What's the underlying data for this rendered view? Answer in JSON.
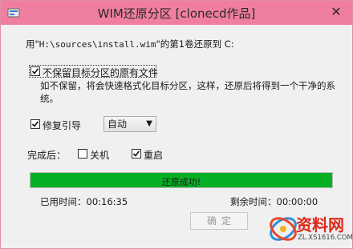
{
  "window": {
    "title": "WIM还原分区 [clonecd作品]",
    "close_glyph": "✕",
    "titlebar_color": "#f07ea0"
  },
  "source": {
    "prefix": "用\"",
    "path": "H:\\sources\\install.wim",
    "suffix": "\"的第1卷还原到 C:"
  },
  "options": {
    "keep_files": {
      "label": "不保留目标分区的原有文件",
      "checked": true,
      "description": "如不保留，将会快速格式化目标分区，这样，还原后将得到一个干净的系统。"
    },
    "repair_boot": {
      "label": "修复引导",
      "checked": true,
      "mode": "自动"
    }
  },
  "after": {
    "label": "完成后：",
    "shutdown_label": "关机",
    "shutdown_checked": false,
    "reboot_label": "重启",
    "reboot_checked": true
  },
  "progress": {
    "text": "还原成功!",
    "fraction": 1.0,
    "color": "#06b025"
  },
  "times": {
    "elapsed_label": "已用时间：",
    "elapsed_value": "00:16:35",
    "remaining_label": "剩余时间：",
    "remaining_value": "00:00:00"
  },
  "ok_button": {
    "label": "确定",
    "enabled": false
  },
  "watermark": {
    "text": "资料网",
    "url": "ZL.XS1616.COM"
  }
}
